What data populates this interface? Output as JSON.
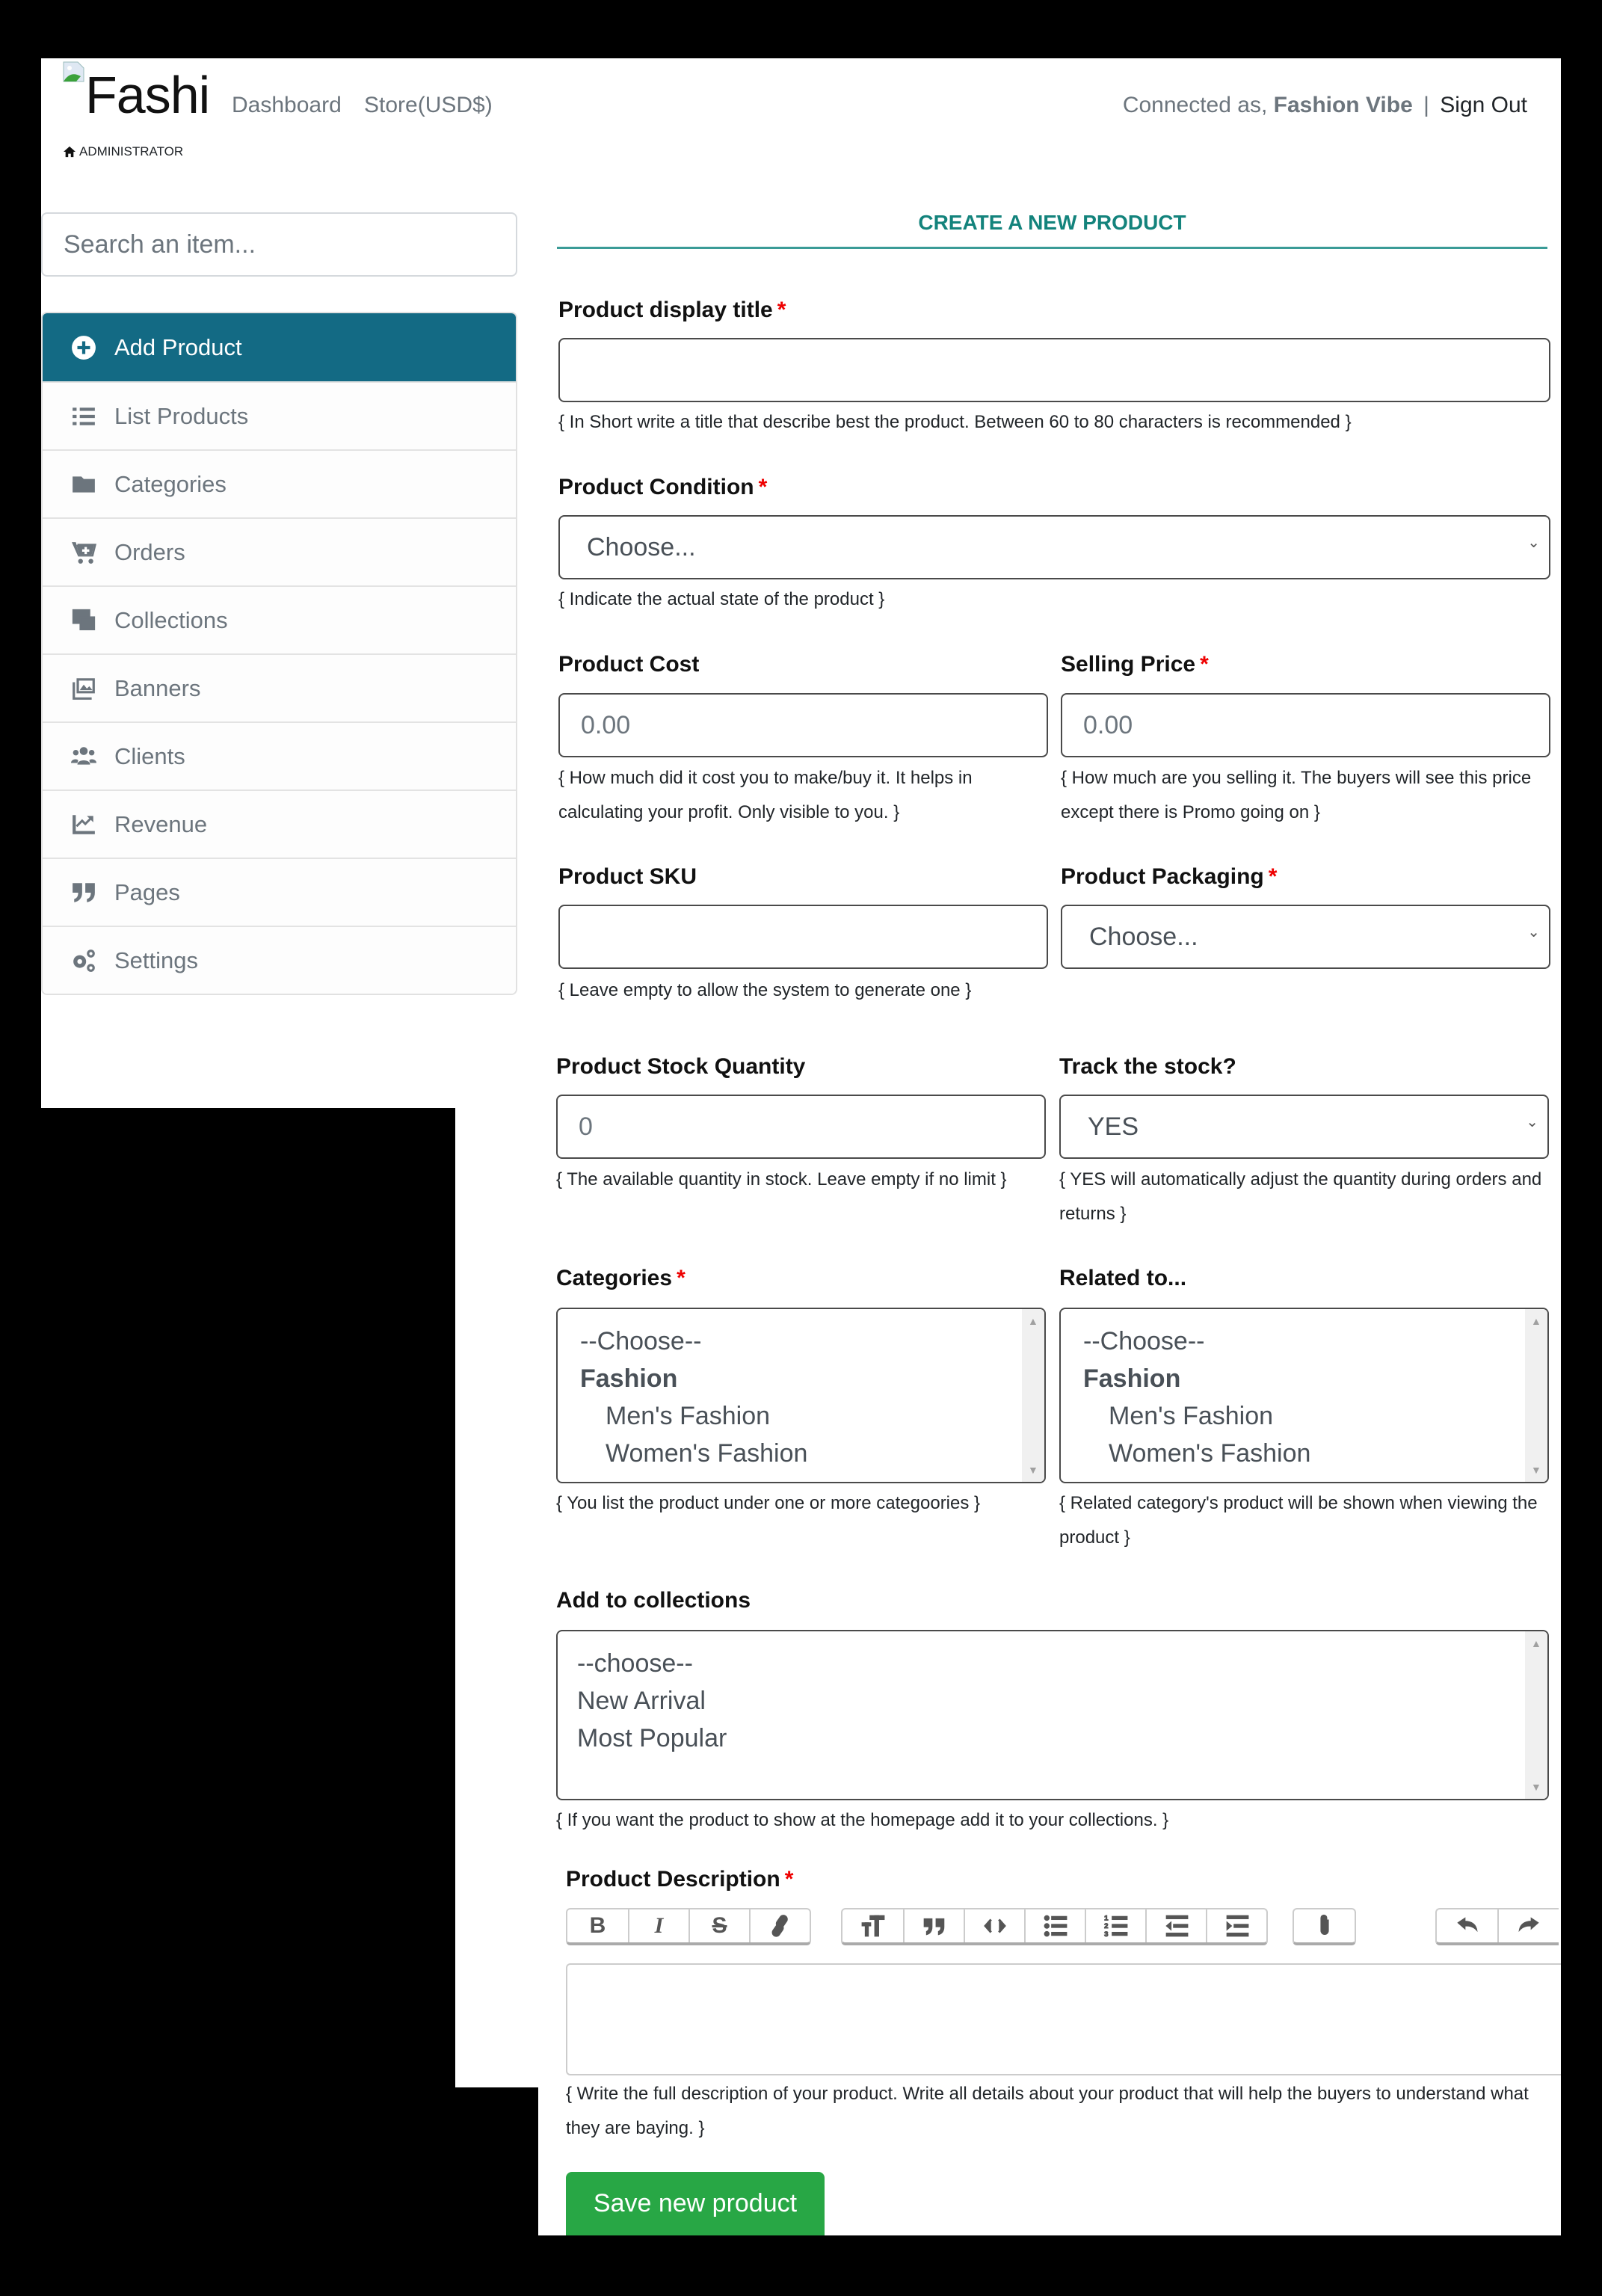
{
  "header": {
    "brand": "Fashi",
    "nav": [
      {
        "label": "Dashboard"
      },
      {
        "label": "Store(USD$)"
      }
    ],
    "role": "ADMINISTRATOR",
    "connected_prefix": "Connected as,",
    "user_name": "Fashion Vibe",
    "separator": "|",
    "sign_out": "Sign Out"
  },
  "sidebar": {
    "search_placeholder": "Search an item...",
    "items": [
      {
        "label": "Add Product",
        "icon": "plus-circle-icon",
        "active": true
      },
      {
        "label": "List Products",
        "icon": "list-icon",
        "active": false
      },
      {
        "label": "Categories",
        "icon": "folder-icon",
        "active": false
      },
      {
        "label": "Orders",
        "icon": "cart-plus-icon",
        "active": false
      },
      {
        "label": "Collections",
        "icon": "object-group-icon",
        "active": false
      },
      {
        "label": "Banners",
        "icon": "images-icon",
        "active": false
      },
      {
        "label": "Clients",
        "icon": "users-icon",
        "active": false
      },
      {
        "label": "Revenue",
        "icon": "chart-line-icon",
        "active": false
      },
      {
        "label": "Pages",
        "icon": "quote-right-icon",
        "active": false
      },
      {
        "label": "Settings",
        "icon": "cogs-icon",
        "active": false
      }
    ]
  },
  "form": {
    "title": "CREATE A NEW PRODUCT",
    "required_mark": "*",
    "display_title": {
      "label": "Product display title",
      "value": "",
      "help": "{ In Short write a title that describe best the product. Between 60 to 80 characters is recommended }"
    },
    "condition": {
      "label": "Product Condition",
      "selected": "Choose...",
      "help": "{ Indicate the actual state of the product }"
    },
    "cost": {
      "label": "Product Cost",
      "placeholder": "0.00",
      "help": "{ How much did it cost you to make/buy it. It helps in calculating your profit. Only visible to you. }"
    },
    "price": {
      "label": "Selling Price",
      "placeholder": "0.00",
      "help": "{ How much are you selling it. The buyers will see this price except there is Promo going on }"
    },
    "sku": {
      "label": "Product SKU",
      "value": "",
      "help": "{ Leave empty to allow the system to generate one }"
    },
    "packaging": {
      "label": "Product Packaging",
      "selected": "Choose..."
    },
    "stock": {
      "label": "Product Stock Quantity",
      "placeholder": "0",
      "help": "{ The available quantity in stock. Leave empty if no limit }"
    },
    "track": {
      "label": "Track the stock?",
      "selected": "YES",
      "help": "{ YES will automatically adjust the quantity during orders and returns }"
    },
    "categories": {
      "label": "Categories",
      "options": [
        {
          "label": "--Choose--",
          "type": "placeholder"
        },
        {
          "label": "Fashion",
          "type": "group"
        },
        {
          "label": "Men's Fashion",
          "type": "child"
        },
        {
          "label": "Women's Fashion",
          "type": "child"
        }
      ],
      "help": "{ You list the product under one or more categoories }"
    },
    "related": {
      "label": "Related to...",
      "options": [
        {
          "label": "--Choose--",
          "type": "placeholder"
        },
        {
          "label": "Fashion",
          "type": "group"
        },
        {
          "label": "Men's Fashion",
          "type": "child"
        },
        {
          "label": "Women's Fashion",
          "type": "child"
        }
      ],
      "help": "{ Related category's product will be shown when viewing the product }"
    },
    "collections": {
      "label": "Add to collections",
      "options": [
        {
          "label": "--choose--"
        },
        {
          "label": "New Arrival"
        },
        {
          "label": "Most Popular"
        }
      ],
      "help": "{ If you want the product to show at the homepage add it to your collections. }"
    },
    "description": {
      "label": "Product Description",
      "value": "",
      "toolbar": [
        [
          "bold-icon",
          "italic-icon",
          "strikethrough-icon",
          "link-icon"
        ],
        [
          "heading-icon",
          "quote-icon",
          "code-icon",
          "bullet-list-icon",
          "numbered-list-icon",
          "outdent-icon",
          "indent-icon"
        ],
        [
          "attach-icon"
        ],
        [
          "undo-icon",
          "redo-icon"
        ]
      ],
      "help": "{ Write the full description of your product. Write all details about your product that will help the buyers to understand what they are baying. }"
    },
    "save_label": "Save new product"
  },
  "colors": {
    "sidebar_active": "#136a84",
    "title_accent": "#13837c",
    "required": "#ee0000",
    "save_button": "#28a745"
  }
}
